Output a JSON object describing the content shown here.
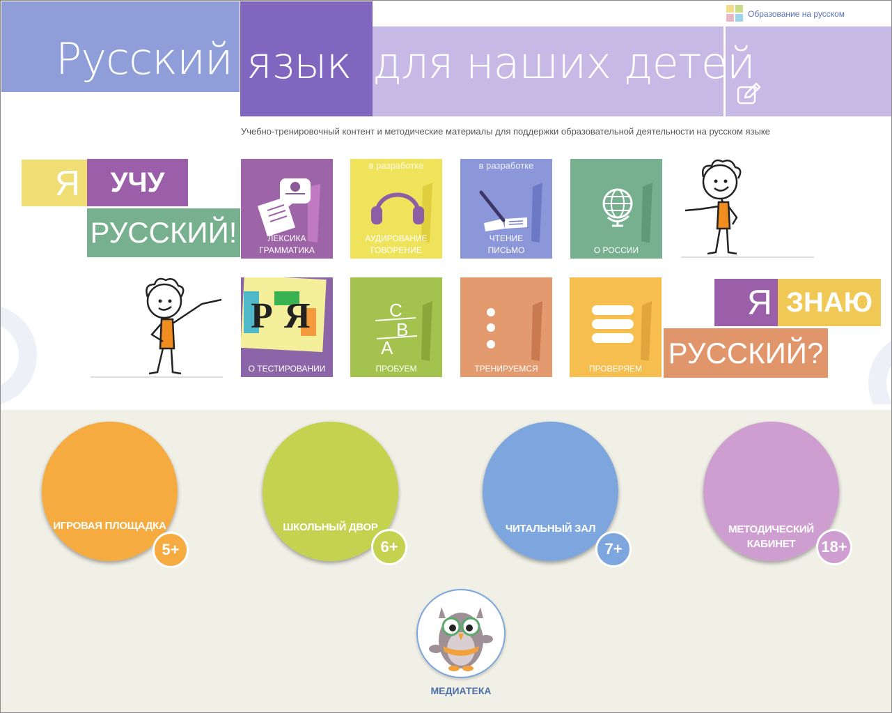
{
  "header": {
    "title_part1": "Русский",
    "title_part2": "язык",
    "title_part3": "для наших детей",
    "edu_link": "Образование на русском",
    "tagline": "Учебно-тренировочный контент и методические материалы для поддержки образовательной деятельности на русском языке"
  },
  "slogan_learn": {
    "w1": "Я",
    "w2": "УЧУ",
    "w3": "РУССКИЙ!"
  },
  "slogan_know": {
    "w1": "Я",
    "w2": "ЗНАЮ",
    "w3": "РУССКИЙ?"
  },
  "learn_tiles": [
    {
      "label1": "ЛЕКСИКА",
      "label2": "ГРАММАТИКА",
      "color": "#9e64a8"
    },
    {
      "badge": "в разработке",
      "label1": "АУДИРОВАНИЕ",
      "label2": "ГОВОРЕНИЕ",
      "color": "#efe35c"
    },
    {
      "badge": "в разработке",
      "label1": "ЧТЕНИЕ",
      "label2": "ПИСЬМО",
      "color": "#8b97d8"
    },
    {
      "label1": "О РОССИИ",
      "color": "#76b08f"
    }
  ],
  "test_tiles": [
    {
      "label1": "О ТЕСТИРОВАНИИ",
      "color": "#8c64a8"
    },
    {
      "label1": "ПРОБУЕМ",
      "color": "#a4c34e"
    },
    {
      "label1": "ТРЕНИРУЕМСЯ",
      "color": "#e29a6e"
    },
    {
      "label1": "ПРОВЕРЯЕМ",
      "color": "#f6be4e"
    }
  ],
  "sections": [
    {
      "label1": "ИГРОВАЯ ПЛОЩАДКА",
      "age": "5+",
      "color": "#f5ab3f"
    },
    {
      "label1": "ШКОЛЬНЫЙ ДВОР",
      "age": "6+",
      "color": "#c4d24f"
    },
    {
      "label1": "ЧИТАЛЬНЫЙ ЗАЛ",
      "age": "7+",
      "color": "#7ca6dd"
    },
    {
      "label1": "МЕТОДИЧЕСКИЙ",
      "label2": "КАБИНЕТ",
      "age": "18+",
      "color": "#cf9ed0"
    }
  ],
  "media": {
    "label": "МЕДИАТЕКА"
  }
}
